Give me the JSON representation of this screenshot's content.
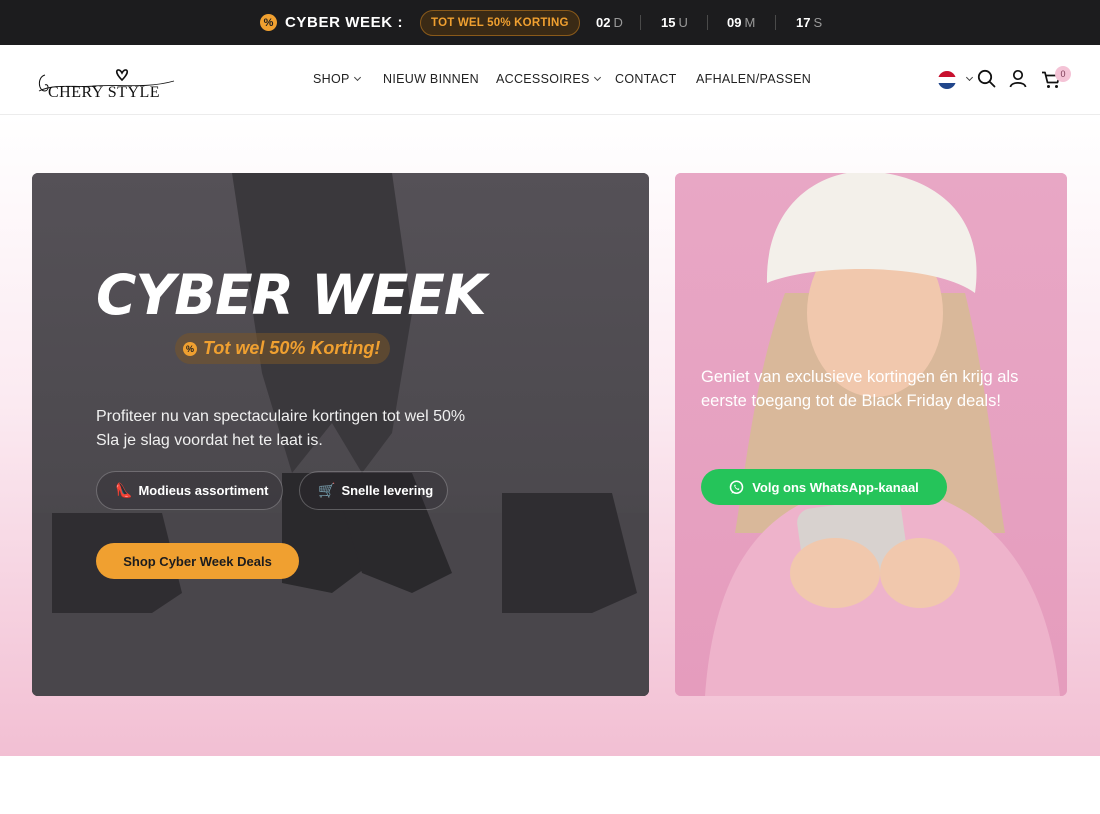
{
  "promo_bar": {
    "title": "CYBER WEEK :",
    "badge": "TOT WEL 50% KORTING",
    "countdown": [
      {
        "value": "02",
        "unit": "D"
      },
      {
        "value": "15",
        "unit": "U"
      },
      {
        "value": "09",
        "unit": "M"
      },
      {
        "value": "17",
        "unit": "S"
      }
    ]
  },
  "header": {
    "logo_text": "CHERY STYLE",
    "nav": [
      {
        "label": "SHOP",
        "dropdown": true
      },
      {
        "label": "NIEUW BINNEN",
        "dropdown": false
      },
      {
        "label": "ACCESSOIRES",
        "dropdown": true
      },
      {
        "label": "CONTACT",
        "dropdown": false
      },
      {
        "label": "AFHALEN/PASSEN",
        "dropdown": false
      }
    ],
    "language_flag": "flag-netherlands-icon",
    "cart_count": "0"
  },
  "hero_left": {
    "title": "CYBER WEEK",
    "discount_pill": "Tot wel 50% Korting!",
    "text_line_1": "Profiteer nu van spectaculaire kortingen tot wel 50%",
    "text_line_2": "Sla je slag voordat het te laat is.",
    "chips": [
      {
        "icon": "heel-icon",
        "label": "Modieus assortiment"
      },
      {
        "icon": "delivery-icon",
        "label": "Snelle levering"
      }
    ],
    "cta": "Shop Cyber Week Deals"
  },
  "hero_right": {
    "text": "Geniet van exclusieve kortingen én krijg als eerste toegang tot de Black Friday deals!",
    "cta": "Volg ons WhatsApp-kanaal"
  },
  "colors": {
    "accent": "#f0a030",
    "whatsapp": "#25c45a",
    "promo_bar": "#1c1c1e",
    "pink": "#f2bfd3"
  }
}
